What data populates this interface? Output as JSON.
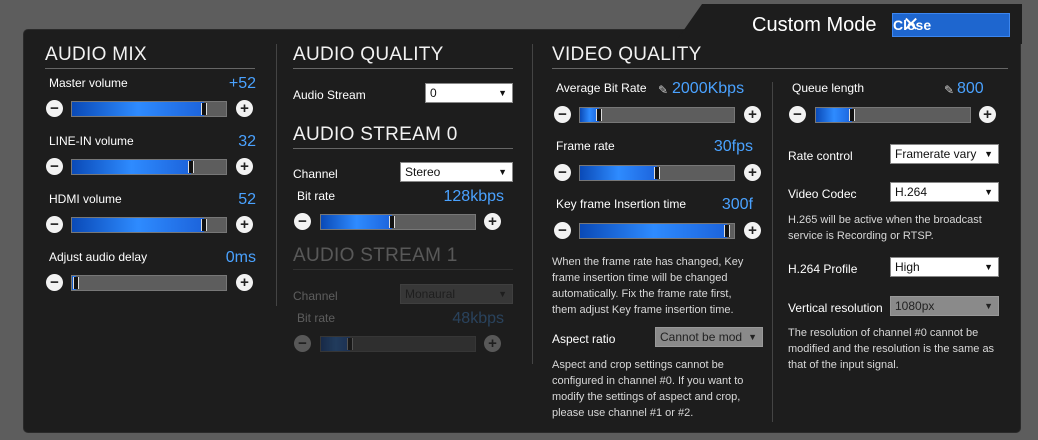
{
  "header": {
    "title": "Custom Mode",
    "close_label": "Close"
  },
  "audio_mix": {
    "title": "AUDIO MIX",
    "master": {
      "label": "Master volume",
      "value": "+52",
      "level": 0.88
    },
    "line_in": {
      "label": "LINE-IN volume",
      "value": "32",
      "level": 0.79
    },
    "hdmi": {
      "label": "HDMI volume",
      "value": "52",
      "level": 0.88
    },
    "delay": {
      "label": "Adjust audio delay",
      "value": "0ms",
      "level": 0.0
    }
  },
  "audio_quality": {
    "title": "AUDIO QUALITY",
    "stream_label": "Audio Stream",
    "stream_value": "0"
  },
  "audio_stream0": {
    "title": "AUDIO STREAM 0",
    "channel_label": "Channel",
    "channel_value": "Stereo",
    "bitrate_label": "Bit rate",
    "bitrate_value": "128kbps",
    "bitrate_level": 0.46
  },
  "audio_stream1": {
    "title": "AUDIO STREAM 1",
    "channel_label": "Channel",
    "channel_value": "Monaural",
    "bitrate_label": "Bit rate",
    "bitrate_value": "48kbps",
    "bitrate_level": 0.17
  },
  "video_quality": {
    "title": "VIDEO QUALITY",
    "avg_bitrate": {
      "label": "Average Bit Rate",
      "value": "2000Kbps",
      "level": 0.1
    },
    "frame_rate": {
      "label": "Frame rate",
      "value": "30fps",
      "level": 0.5
    },
    "key_frame": {
      "label": "Key frame Insertion time",
      "value": "300f",
      "level": 0.98
    },
    "frame_note": "When the frame rate has changed, Key frame insertion time will be changed automatically. Fix the frame rate first, them adjust Key frame insertion time.",
    "aspect_label": "Aspect ratio",
    "aspect_value": "Cannot be mod",
    "aspect_note": "Aspect and crop settings cannot be configured in channel #0. If you want to modify the settings of aspect and crop, please use channel #1 or #2.",
    "queue": {
      "label": "Queue length",
      "value": "800",
      "level": 0.22
    },
    "rate_control_label": "Rate control",
    "rate_control_value": "Framerate vary",
    "codec_label": "Video Codec",
    "codec_value": "H.264",
    "codec_note": "H.265 will be active when the broadcast service is Recording or RTSP.",
    "profile_label": "H.264 Profile",
    "profile_value": "High",
    "vres_label": "Vertical resolution",
    "vres_value": "1080px",
    "vres_note": "The resolution of channel #0 cannot be modified and the resolution is the same as that of the input signal."
  },
  "icons": {
    "minus": "−",
    "plus": "+",
    "close": "✕",
    "pencil": "✎",
    "arrow": "▼"
  },
  "colors": {
    "accent_blue": "#4aa2ff",
    "close_button": "#1e66cf",
    "panel_bg": "#1d1d1d"
  }
}
